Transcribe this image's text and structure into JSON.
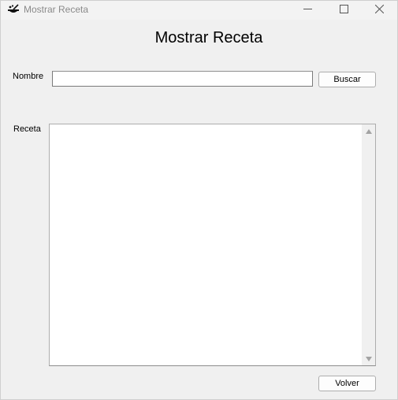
{
  "window": {
    "title": "Mostrar Receta",
    "controls": {
      "minimize_icon": "minimize-icon",
      "maximize_icon": "maximize-icon",
      "close_icon": "close-icon"
    }
  },
  "form": {
    "heading": "Mostrar Receta",
    "nombre_label": "Nombre",
    "nombre_value": "",
    "buscar_label": "Buscar",
    "receta_label": "Receta",
    "receta_value": "",
    "volver_label": "Volver"
  },
  "colors": {
    "window_bg": "#f0f0f0",
    "title_text": "#8a8a8a",
    "button_border": "#adadad"
  }
}
